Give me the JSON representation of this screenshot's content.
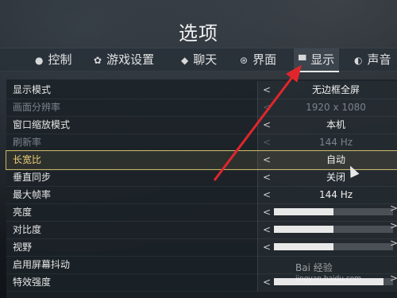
{
  "title": "选项",
  "tabs": [
    {
      "label": "控制",
      "icon": "mouse-icon"
    },
    {
      "label": "游戏设置",
      "icon": "gear-icon"
    },
    {
      "label": "聊天",
      "icon": "chat-icon"
    },
    {
      "label": "界面",
      "icon": "interface-icon"
    },
    {
      "label": "显示",
      "icon": "monitor-icon",
      "active": true
    },
    {
      "label": "声音",
      "icon": "speaker-icon"
    }
  ],
  "settings": [
    {
      "label": "显示模式",
      "value": "无边框全屏"
    },
    {
      "label": "画面分辨率",
      "value": "1920 x 1080",
      "disabled": true
    },
    {
      "label": "窗口缩放模式",
      "value": "本机"
    },
    {
      "label": "刷新率",
      "value": "144 Hz",
      "disabled": true
    },
    {
      "label": "长宽比",
      "value": "自动",
      "highlight": true
    },
    {
      "label": "垂直同步",
      "value": "关闭"
    },
    {
      "label": "最大帧率",
      "value": "144 Hz"
    },
    {
      "label": "亮度",
      "slider": 0.5
    },
    {
      "label": "对比度",
      "slider": 0.5
    },
    {
      "label": "视野",
      "slider": 0.5
    },
    {
      "label": "启用屏幕抖动",
      "value": ""
    },
    {
      "label": "特效强度",
      "slider": 0.92
    }
  ],
  "watermark": {
    "text": "Bai 经验",
    "sub": "jingyan.baidu.com"
  },
  "colors": {
    "highlight": "#c8b560",
    "annotation_arrow": "#e0262c"
  }
}
